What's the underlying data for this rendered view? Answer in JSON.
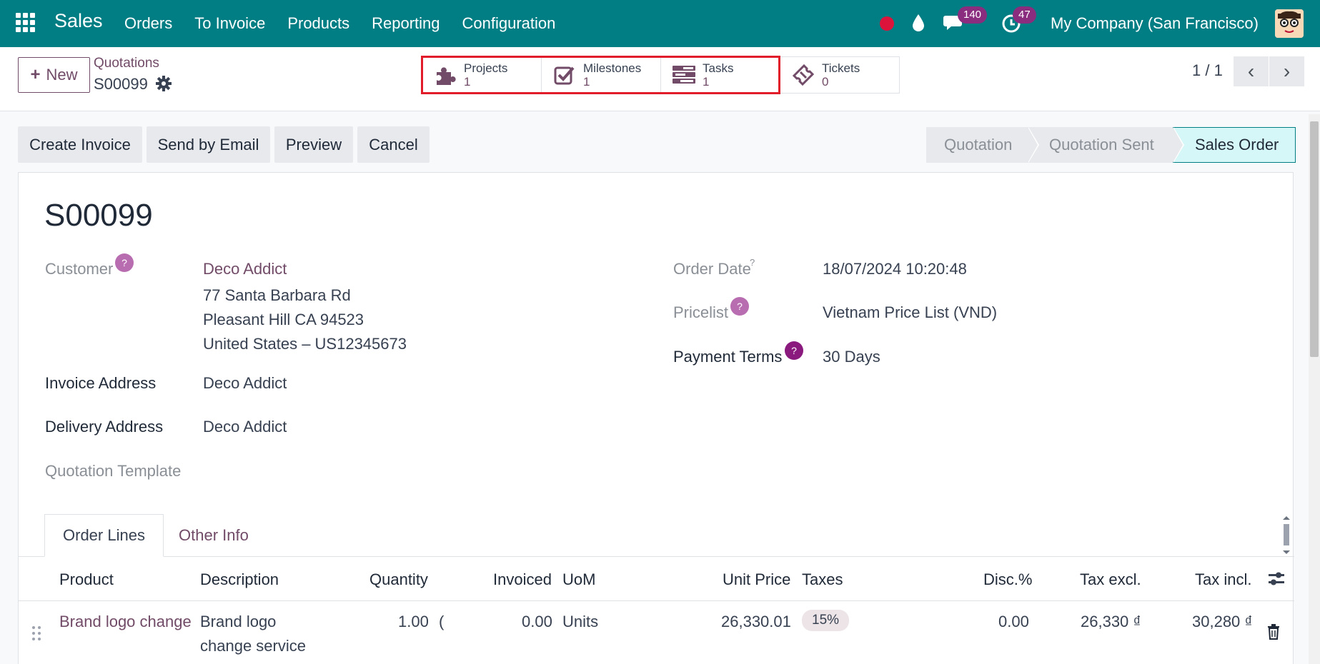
{
  "navbar": {
    "app_name": "Sales",
    "menu": [
      "Orders",
      "To Invoice",
      "Products",
      "Reporting",
      "Configuration"
    ],
    "chat_count": "140",
    "activity_count": "47",
    "company": "My Company (San Francisco)",
    "accent": "#017e84"
  },
  "control": {
    "new_label": "New",
    "breadcrumb_parent": "Quotations",
    "breadcrumb_current": "S00099",
    "smart_buttons": [
      {
        "label": "Projects",
        "count": "1",
        "icon": "puzzle-icon"
      },
      {
        "label": "Milestones",
        "count": "1",
        "icon": "check-square-icon"
      },
      {
        "label": "Tasks",
        "count": "1",
        "icon": "tasks-icon"
      },
      {
        "label": "Tickets",
        "count": "0",
        "icon": "ticket-icon"
      }
    ],
    "pager": "1 / 1"
  },
  "actions": {
    "create_invoice": "Create Invoice",
    "send_email": "Send by Email",
    "preview": "Preview",
    "cancel": "Cancel"
  },
  "statusbar": {
    "steps": [
      "Quotation",
      "Quotation Sent",
      "Sales Order"
    ],
    "active": "Sales Order"
  },
  "form": {
    "title": "S00099",
    "customer_label": "Customer",
    "customer_name": "Deco Addict",
    "address_line1": "77 Santa Barbara Rd",
    "address_line2": "Pleasant Hill CA 94523",
    "address_line3": "United States – US12345673",
    "invoice_address_label": "Invoice Address",
    "invoice_address": "Deco Addict",
    "delivery_address_label": "Delivery Address",
    "delivery_address": "Deco Addict",
    "template_label": "Quotation Template",
    "order_date_label": "Order Date",
    "order_date": "18/07/2024 10:20:48",
    "pricelist_label": "Pricelist",
    "pricelist": "Vietnam Price List (VND)",
    "payment_terms_label": "Payment Terms",
    "payment_terms": "30 Days",
    "help_mark": "?"
  },
  "tabs": [
    "Order Lines",
    "Other Info"
  ],
  "table": {
    "headers": [
      "Product",
      "Description",
      "Quantity",
      "Invoiced",
      "UoM",
      "Unit Price",
      "Taxes",
      "Disc.%",
      "Tax excl.",
      "Tax incl."
    ],
    "rows": [
      {
        "product": "Brand logo change",
        "description_l1": "Brand logo",
        "description_l2": "change service",
        "quantity": "1.00",
        "delivered_cut": "(",
        "invoiced": "0.00",
        "uom": "Units",
        "unit_price": "26,330.01",
        "taxes": "15%",
        "discount": "0.00",
        "tax_excl": "26,330 ₫",
        "tax_incl": "30,280 ₫"
      }
    ]
  }
}
